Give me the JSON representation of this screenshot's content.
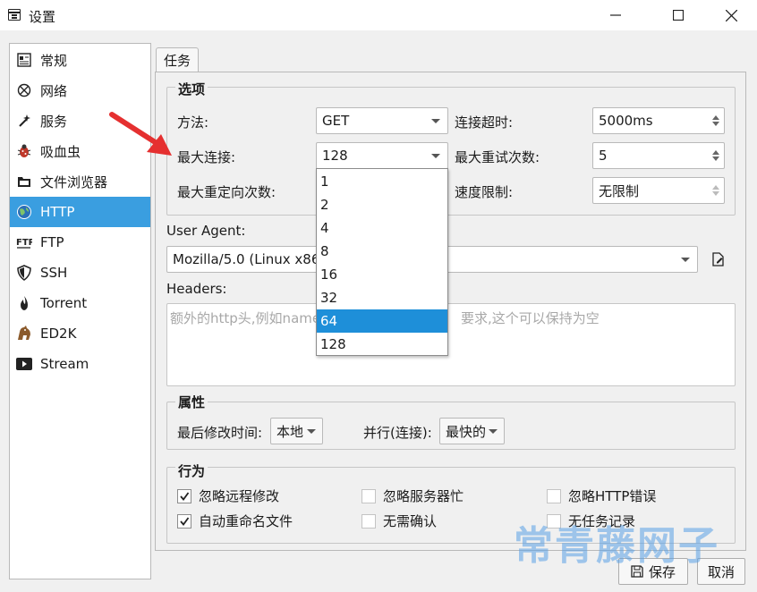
{
  "window": {
    "title": "设置"
  },
  "sidebar": {
    "items": [
      {
        "label": "常规",
        "icon": "general-settings-icon"
      },
      {
        "label": "网络",
        "icon": "network-icon"
      },
      {
        "label": "服务",
        "icon": "magic-wand-icon"
      },
      {
        "label": "吸血虫",
        "icon": "bug-icon"
      },
      {
        "label": "文件浏览器",
        "icon": "folder-icon"
      },
      {
        "label": "HTTP",
        "icon": "globe-icon",
        "selected": true
      },
      {
        "label": "FTP",
        "icon": "ftp-icon"
      },
      {
        "label": "SSH",
        "icon": "shield-icon"
      },
      {
        "label": "Torrent",
        "icon": "torrent-icon"
      },
      {
        "label": "ED2K",
        "icon": "donkey-icon"
      },
      {
        "label": "Stream",
        "icon": "play-icon"
      }
    ]
  },
  "tab": {
    "label": "任务"
  },
  "options": {
    "title": "选项",
    "method_label": "方法:",
    "method_value": "GET",
    "timeout_label": "连接超时:",
    "timeout_value": "5000ms",
    "max_conn_label": "最大连接:",
    "max_conn_value": "128",
    "max_retry_label": "最大重试次数:",
    "max_retry_value": "5",
    "max_redirect_label": "最大重定向次数:",
    "speed_limit_label": "速度限制:",
    "speed_limit_value": "无限制"
  },
  "dropdown": {
    "options": [
      "1",
      "2",
      "4",
      "8",
      "16",
      "32",
      "64",
      "128"
    ],
    "highlighted": "64"
  },
  "user_agent": {
    "label": "User Agent:",
    "value": "Mozilla/5.0 (Linux x86"
  },
  "headers": {
    "label": "Headers:",
    "placeholder_left": "额外的http头,例如name",
    "placeholder_right": "要求,这个可以保持为空"
  },
  "properties": {
    "title": "属性",
    "last_modified_label": "最后修改时间:",
    "last_modified_value": "本地",
    "parallel_label": "并行(连接):",
    "parallel_value": "最快的"
  },
  "behavior": {
    "title": "行为",
    "checkboxes": [
      {
        "label": "忽略远程修改",
        "checked": true
      },
      {
        "label": "忽略服务器忙",
        "checked": false
      },
      {
        "label": "忽略HTTP错误",
        "checked": false
      },
      {
        "label": "自动重命名文件",
        "checked": true
      },
      {
        "label": "无需确认",
        "checked": false
      },
      {
        "label": "无任务记录",
        "checked": false
      }
    ]
  },
  "buttons": {
    "save": "保存",
    "cancel": "取消"
  },
  "watermark": "常青藤网子",
  "colors": {
    "selection": "#3a9ee0",
    "dropdown_highlight": "#1e8fd9",
    "arrow": "#e53030"
  }
}
